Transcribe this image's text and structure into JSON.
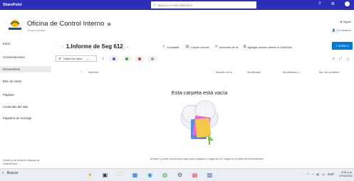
{
  "suite": {
    "brand": "SharePoint",
    "search_placeholder": "Buscar en esta biblioteca"
  },
  "site": {
    "title": "Oficina de Control Interno",
    "subtitle": "Grupo privado",
    "follow_label": "Siguie",
    "members_label": "11 miembro"
  },
  "nav": {
    "items": [
      {
        "label": "Inicio"
      },
      {
        "label": "Conversaciones"
      },
      {
        "label": "Documentos"
      },
      {
        "label": "Bloc de notas"
      },
      {
        "label": "Páginas"
      },
      {
        "label": "Contenido del sitio"
      },
      {
        "label": "Papelera de reciclaje"
      }
    ],
    "footer": "Volver a la versión clásica de SharePoint"
  },
  "breadcrumb": {
    "current": "1.Informe de Seg 612"
  },
  "commands": [
    {
      "label": "Compartir",
      "icon": "share-icon"
    },
    {
      "label": "Copiar vínculo",
      "icon": "link-icon"
    },
    {
      "label": "Acciones de la",
      "icon": "flow-icon"
    },
    {
      "label": "Agregar acceso directo a OneDrive",
      "icon": "shortcut-icon"
    }
  ],
  "new_button": "+ Crear o",
  "view": {
    "current": "Todos los docu..."
  },
  "columns": [
    "Nombre",
    "Tamaño de a...",
    "Modificado",
    "Modificado p...",
    "Tipo de contenid"
  ],
  "empty": {
    "title": "Esta carpeta está vacía",
    "message": "Arrastre y suelte los archivos aquí para cargarlos o haga clic en Cargar en la barra de herramientas"
  },
  "taskbar": {
    "search_label": "Buscar",
    "tray_lang": "ESP",
    "time": "3:05 p.m.",
    "date": "27/04/2021"
  },
  "colors": {
    "suite_bar": "#2b2fb6",
    "accent": "#0078d4"
  }
}
